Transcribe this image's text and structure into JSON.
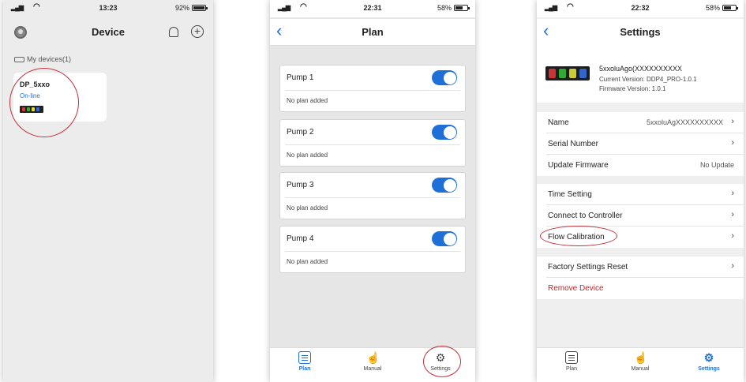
{
  "phone1": {
    "status": {
      "time": "13:23",
      "battery_text": "92%",
      "battery_level": 0.92
    },
    "title": "Device",
    "section_label": "My devices(1)",
    "device": {
      "name": "DP_5xxo",
      "status": "On-line"
    },
    "icons": [
      "avatar-icon",
      "bell-icon",
      "add-icon",
      "device-thumbnail"
    ]
  },
  "phone2": {
    "status": {
      "time": "22:31",
      "battery_text": "58%",
      "battery_level": 0.58
    },
    "title": "Plan",
    "pumps": [
      {
        "name": "Pump 1",
        "status": "No plan added",
        "enabled": true
      },
      {
        "name": "Pump 2",
        "status": "No plan added",
        "enabled": true
      },
      {
        "name": "Pump 3",
        "status": "No plan added",
        "enabled": true
      },
      {
        "name": "Pump 4",
        "status": "No plan added",
        "enabled": true
      }
    ],
    "tabs": [
      {
        "label": "Plan",
        "icon": "plan-icon",
        "active": true
      },
      {
        "label": "Manual",
        "icon": "hand-icon",
        "active": false
      },
      {
        "label": "Settings",
        "icon": "gear-icon",
        "active": false
      }
    ]
  },
  "phone3": {
    "status": {
      "time": "22:32",
      "battery_text": "58%",
      "battery_level": 0.58
    },
    "title": "Settings",
    "device": {
      "name": "5xxoluAgo(XXXXXXXXXX",
      "current_version": "Current Version: DDP4_PRO-1.0.1",
      "firmware_version": "Firmware Version: 1.0.1"
    },
    "rows": [
      {
        "label": "Name",
        "value": "5xxoluAgXXXXXXXXXX",
        "chevron": true
      },
      {
        "label": "Serial Number",
        "value": "",
        "chevron": true
      },
      {
        "label": "Update Firmware",
        "value": "No Update",
        "chevron": false
      },
      {
        "label": "Time Setting",
        "value": "",
        "chevron": true
      },
      {
        "label": "Connect to Controller",
        "value": "",
        "chevron": true
      },
      {
        "label": "Flow Calibration",
        "value": "",
        "chevron": true
      },
      {
        "label": "Factory Settings Reset",
        "value": "",
        "chevron": true
      },
      {
        "label": "Remove Device",
        "value": "",
        "chevron": false
      }
    ],
    "tabs": [
      {
        "label": "Plan",
        "icon": "plan-icon",
        "active": false
      },
      {
        "label": "Manual",
        "icon": "hand-icon",
        "active": false
      },
      {
        "label": "Settings",
        "icon": "gear-icon",
        "active": true
      }
    ]
  },
  "colors": {
    "accent": "#1f6fd8",
    "annotation": "#c0303a",
    "danger": "#b42828"
  }
}
